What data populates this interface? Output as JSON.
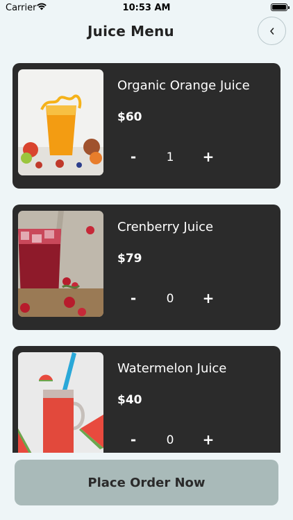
{
  "status": {
    "carrier": "Carrier",
    "time": "10:53 AM"
  },
  "header": {
    "title": "Juice Menu",
    "back_icon": "chevron-left-icon"
  },
  "juices": [
    {
      "name": "Organic Orange Juice",
      "price": "$60",
      "qty": "1",
      "minus": "-",
      "plus": "+"
    },
    {
      "name": "Crenberry Juice",
      "price": "$79",
      "qty": "0",
      "minus": "-",
      "plus": "+"
    },
    {
      "name": "Watermelon Juice",
      "price": "$40",
      "qty": "0",
      "minus": "-",
      "plus": "+"
    }
  ],
  "order_button": {
    "label": "Place Order Now"
  },
  "colors": {
    "background": "#eef5f7",
    "card": "#2b2b2b",
    "order_button": "#a9bab9"
  }
}
